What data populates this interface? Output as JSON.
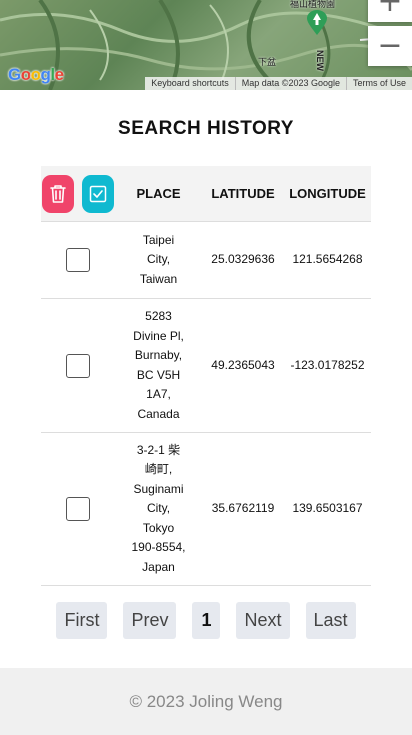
{
  "map": {
    "zoom_in_label": "+",
    "zoom_out_label": "−",
    "logo_letters": [
      "G",
      "o",
      "o",
      "g",
      "l",
      "e"
    ],
    "labels": {
      "park": "福山植物園",
      "village": "下盆",
      "road": "NEW"
    },
    "footer": {
      "shortcuts": "Keyboard shortcuts",
      "map_data": "Map data ©2023 Google",
      "terms": "Terms of Use"
    }
  },
  "page": {
    "title": "SEARCH HISTORY"
  },
  "table": {
    "headers": {
      "place": "PLACE",
      "latitude": "LATITUDE",
      "longitude": "LONGITUDE"
    },
    "rows": [
      {
        "place_lines": [
          "Taipei",
          "City,",
          "Taiwan"
        ],
        "latitude": "25.0329636",
        "longitude": "121.5654268",
        "checked": false
      },
      {
        "place_lines": [
          "5283",
          "Divine Pl,",
          "Burnaby,",
          "BC V5H",
          "1A7,",
          "Canada"
        ],
        "latitude": "49.2365043",
        "longitude": "-123.0178252",
        "checked": false
      },
      {
        "place_lines": [
          "3-2-1 柴",
          "崎町,",
          "Suginami",
          "City,",
          "Tokyo",
          "190-8554,",
          "Japan"
        ],
        "latitude": "35.6762119",
        "longitude": "139.6503167",
        "checked": false
      }
    ]
  },
  "pagination": {
    "first": "First",
    "prev": "Prev",
    "current": "1",
    "next": "Next",
    "last": "Last"
  },
  "footer": {
    "copyright": "© 2023 Joling Weng"
  },
  "colors": {
    "delete_button": "#f0446a",
    "select_all_button": "#0fb9d0"
  }
}
